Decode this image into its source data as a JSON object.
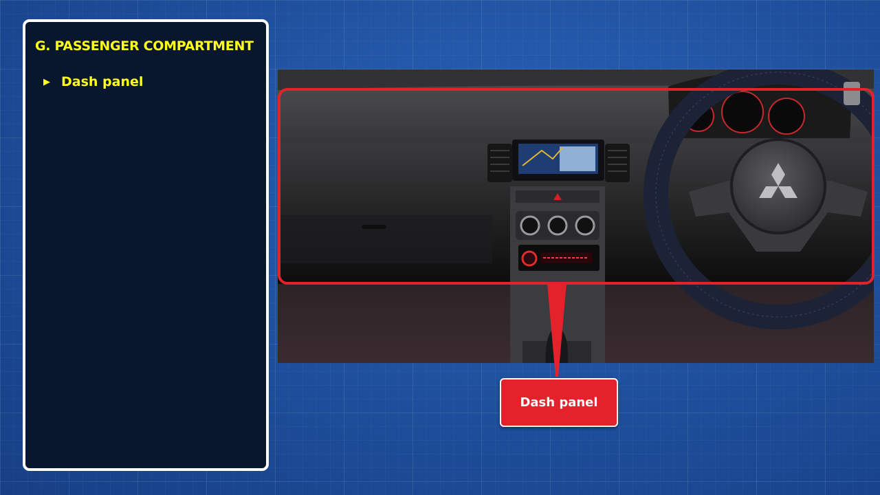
{
  "sidebar": {
    "section_title": "G. PASSENGER COMPARTMENT",
    "items": [
      {
        "bullet": "▶",
        "label": "Dash panel"
      }
    ]
  },
  "figure": {
    "callout_label": "Dash panel",
    "logo": "mitsubishi-logo"
  },
  "colors": {
    "highlight": "#e3222b",
    "title_text": "#ffff1a",
    "panel_bg": "#08172e",
    "page_bg": "#1f4f9c"
  }
}
